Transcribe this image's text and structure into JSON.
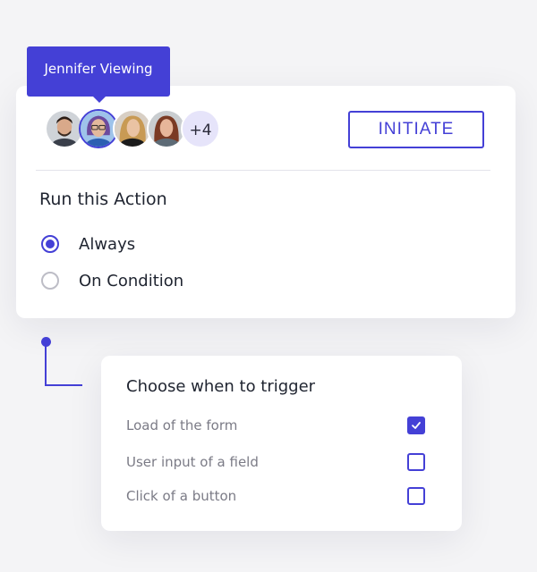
{
  "tooltip": {
    "text": "Jennifer Viewing"
  },
  "collaborators": {
    "more_count": "+4",
    "avatars": [
      {
        "name": "collaborator-avatar-1",
        "skin": "#d9a98a",
        "hair": "#2b1d16",
        "shirt": "#3a3f4a"
      },
      {
        "name": "collaborator-avatar-2",
        "skin": "#e3b99c",
        "hair": "#6c4a9e",
        "shirt": "#2c5fb2",
        "active": true
      },
      {
        "name": "collaborator-avatar-3",
        "skin": "#eac3a3",
        "hair": "#c89a54",
        "shirt": "#1b1b1b"
      },
      {
        "name": "collaborator-avatar-4",
        "skin": "#e7b69a",
        "hair": "#7a3a24",
        "shirt": "#5d6b76"
      }
    ]
  },
  "action": {
    "initiate_label": "INITIATE",
    "title": "Run this Action",
    "options": [
      {
        "label": "Always",
        "checked": true
      },
      {
        "label": "On Condition",
        "checked": false
      }
    ]
  },
  "trigger": {
    "title": "Choose when to trigger",
    "options": [
      {
        "label": "Load of the form",
        "checked": true
      },
      {
        "label": "User input of a field",
        "checked": false
      },
      {
        "label": "Click of a button",
        "checked": false
      }
    ]
  },
  "colors": {
    "accent": "#4440d6",
    "background": "#f4f4f6",
    "card": "#ffffff",
    "muted_text": "#7b7b86"
  }
}
